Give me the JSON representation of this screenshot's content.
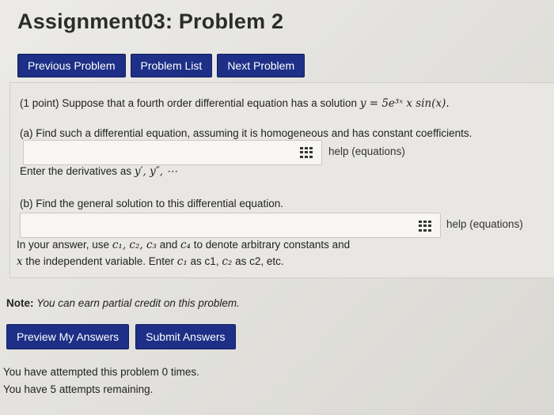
{
  "page_title": "Assignment03: Problem 2",
  "nav": {
    "previous": "Previous Problem",
    "list": "Problem List",
    "next": "Next Problem"
  },
  "problem": {
    "intro": "(1 point) Suppose that a fourth order differential equation has a solution",
    "solution_math": "y = 5e³ˣ x sin(x).",
    "part_a": "(a) Find such a differential equation, assuming it is homogeneous and has constant coefficients.",
    "help_label": "help (equations)",
    "deriv_text": "Enter the derivatives as",
    "deriv_math": "y′, y″, ⋯",
    "part_b": "(b) Find the general solution to this differential equation.",
    "help_label_b": "help (equations)",
    "constants_prefix": "In your answer, use",
    "constants_math": "c₁, c₂, c₃",
    "constants_and": "and",
    "constants_math2": "c₄",
    "constants_suffix": "to denote arbitrary constants and",
    "indep_math": "x",
    "indep_text": "the independent variable. Enter",
    "c1_math": "c₁",
    "as_c1": "as c1,",
    "c2_math": "c₂",
    "as_c2": "as c2, etc."
  },
  "note": {
    "label": "Note:",
    "text": "You can earn partial credit on this problem."
  },
  "actions": {
    "preview": "Preview My Answers",
    "submit": "Submit Answers"
  },
  "attempts": {
    "line1": "You have attempted this problem 0 times.",
    "line2": "You have 5 attempts remaining."
  }
}
